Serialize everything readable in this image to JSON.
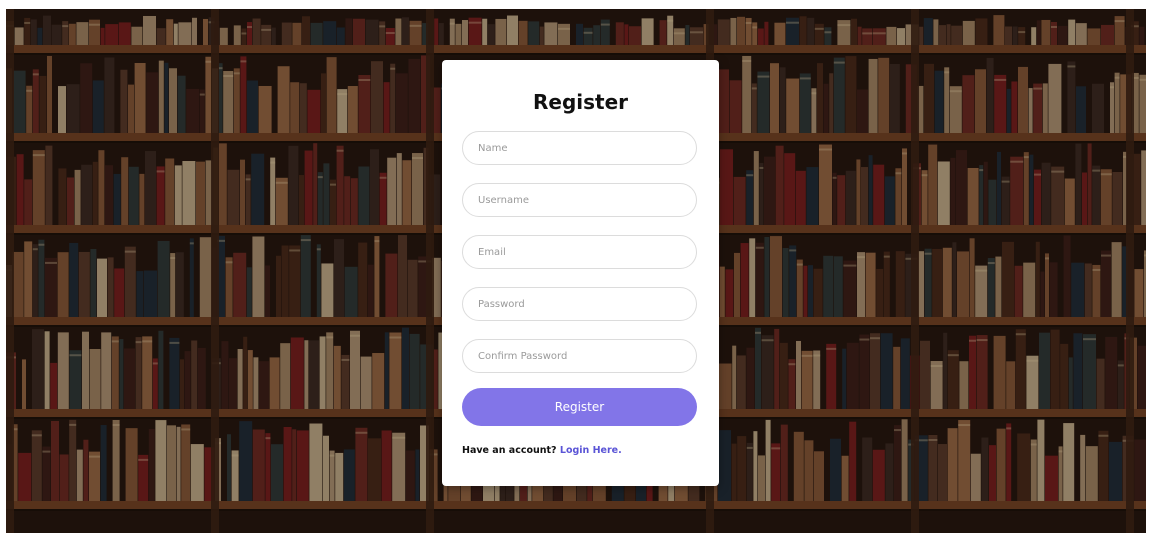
{
  "background": {
    "description_icon": "bookshelf-photo",
    "colors": {
      "wood": "#5a3420",
      "shadow": "#1c110b"
    }
  },
  "form": {
    "title": "Register",
    "fields": {
      "name": {
        "placeholder": "Name",
        "value": ""
      },
      "username": {
        "placeholder": "Username",
        "value": ""
      },
      "email": {
        "placeholder": "Email",
        "value": ""
      },
      "password": {
        "placeholder": "Password",
        "value": ""
      },
      "confirm_password": {
        "placeholder": "Confirm Password",
        "value": ""
      }
    },
    "submit_label": "Register",
    "footer": {
      "prompt": "Have an account?",
      "link_label": "Login Here."
    }
  },
  "colors": {
    "accent": "#8275e8",
    "link": "#5a54d6",
    "card": "#ffffff"
  }
}
